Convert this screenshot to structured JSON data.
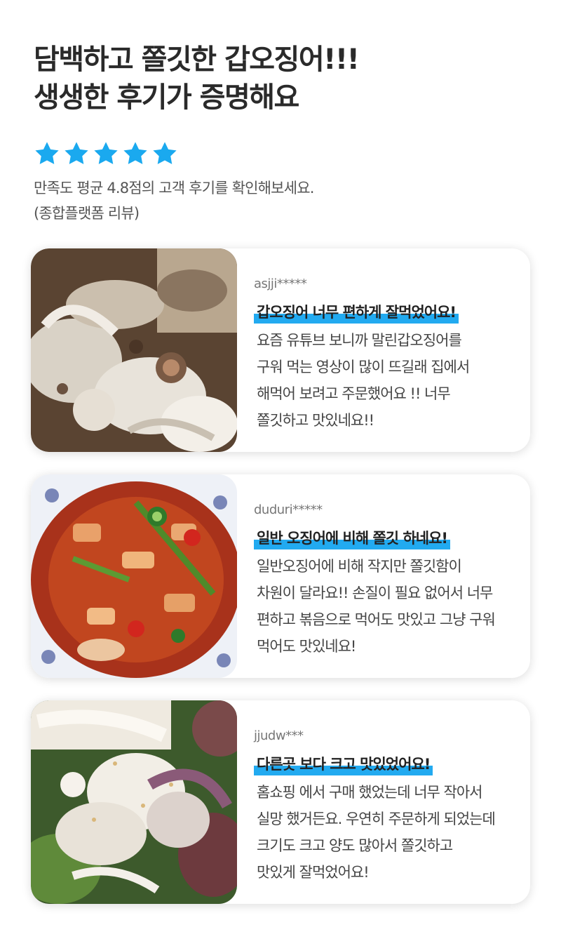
{
  "header": {
    "line1": "담백하고 쫄깃한 갑오징어!!!",
    "line2": "생생한 후기가 증명해요"
  },
  "rating": {
    "stars": 5,
    "star_color": "#1aa9ef",
    "summary_line1": "만족도 평균 4.8점의 고객 후기를 확인해보세요.",
    "summary_line2": "(종합플랫폼 리뷰)"
  },
  "reviews": [
    {
      "user": "asjji*****",
      "title": "갑오징어 너무 편하게 잘먹었어요!",
      "lines": [
        "요즘 유튜브 보니까 말린갑오징어를",
        "구워 먹는 영상이 많이 뜨길래 집에서",
        "해먹어 보려고 주문했어요 !! 너무",
        "쫄깃하고 맛있네요!!"
      ]
    },
    {
      "user": "duduri*****",
      "title": "일반 오징어에 비해 쫄깃 하네요!",
      "lines": [
        "일반오징어에 비해 작지만 쫄깃함이",
        "차원이 달라요!! 손질이 필요 없어서 너무",
        "편하고 볶음으로 먹어도 맛있고 그냥 구워",
        "먹어도 맛있네요!"
      ]
    },
    {
      "user": "jjudw***",
      "title": "다른곳 보다 크고 맛있었어요!",
      "lines": [
        "홈쇼핑 에서 구매 했었는데 너무 작아서",
        "실망 했거든요. 우연히 주문하게 되었는데",
        "크기도 크고 양도 많아서  쫄깃하고",
        "맛있게 잘먹었어요!"
      ]
    }
  ],
  "highlight_color": "#22aaf0"
}
